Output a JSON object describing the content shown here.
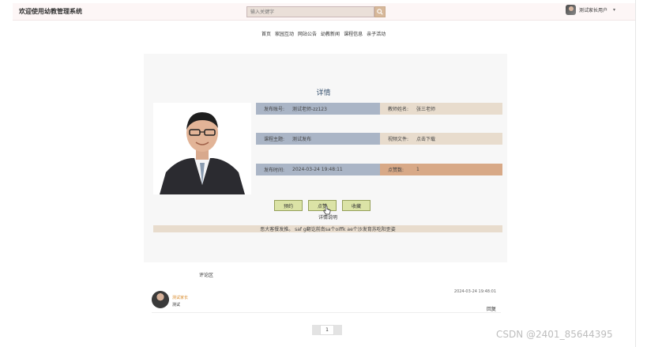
{
  "header": {
    "brand": "欢迎使用幼教管理系统",
    "search_placeholder": "输入关键字",
    "user_name": "测试家长用户",
    "user_caret": "▾"
  },
  "nav": {
    "items": [
      "首页",
      "家园互动",
      "网站公告",
      "幼教新闻",
      "课程信息",
      "亲子活动"
    ]
  },
  "detail": {
    "title": "详情",
    "rows": [
      {
        "label_a": "发布账号:",
        "value_a": "测试老师-zz123",
        "label_b": "教师姓名:",
        "value_b": "张三老师"
      },
      {
        "label_a": "课程主题:",
        "value_a": "测试发布",
        "label_b": "视频文件:",
        "value_b": "点击下载"
      },
      {
        "label_a": "发布时间:",
        "value_a": "2024-03-24 19:48:11",
        "label_b": "点赞数:",
        "value_b": "1"
      }
    ],
    "buttons": [
      "预约",
      "点赞",
      "收藏"
    ],
    "desc_label": "详情说明",
    "desc_text": "恶大客餐发推。 saf g翻讫前南sa个oiffk ae个沙发育苏吃阳歪姿"
  },
  "comments": {
    "section_label": "评论区",
    "items": [
      {
        "user": "测试家长",
        "text": "测试",
        "time": "2024-03-24 19:48:01",
        "reply": "回复"
      }
    ]
  },
  "pager": {
    "current": "1"
  },
  "watermark": "CSDN @2401_85644395",
  "colors": {
    "cell_a": "#aab5c6",
    "cell_b": "#e8dccd",
    "cell_b_dark": "#d8a987",
    "button": "#dbe3a6"
  }
}
